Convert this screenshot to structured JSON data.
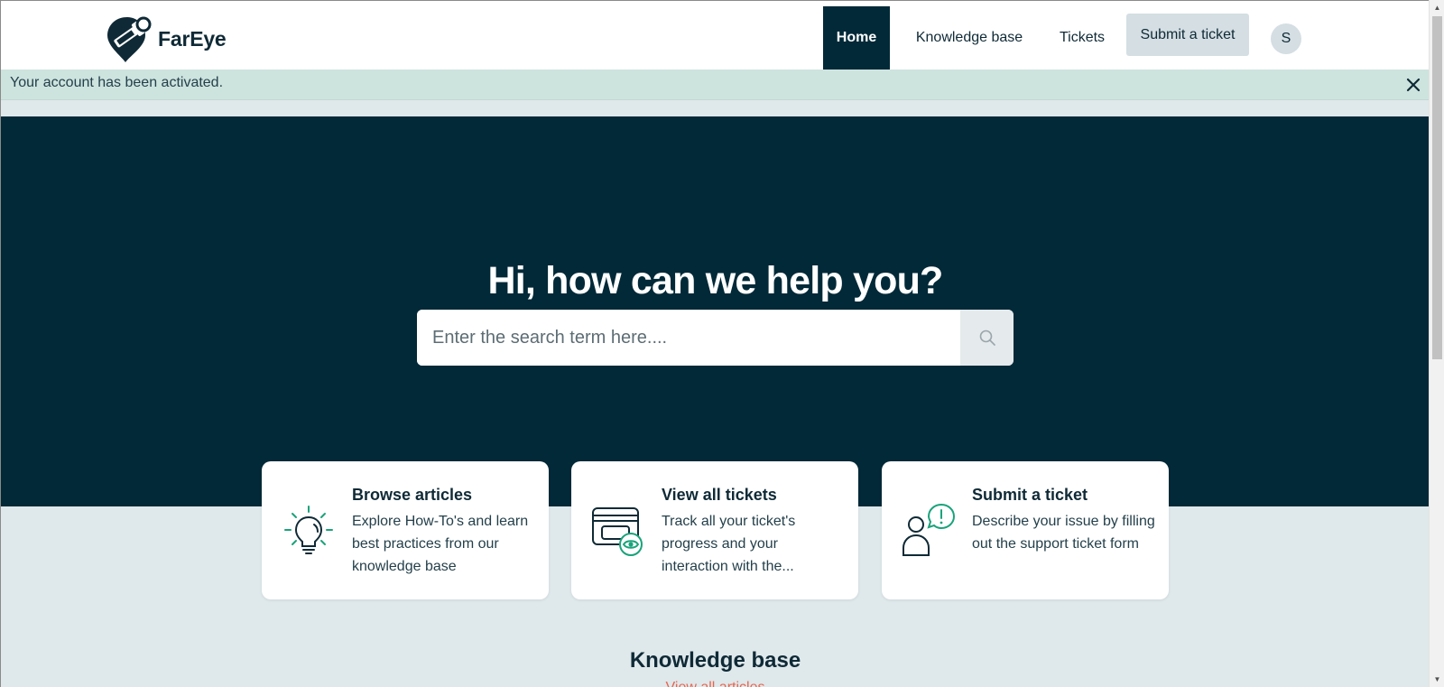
{
  "brand": {
    "name": "FarEye"
  },
  "nav": {
    "home": "Home",
    "knowledge_base": "Knowledge base",
    "tickets": "Tickets",
    "submit": "Submit a ticket",
    "avatar_initial": "S"
  },
  "notice": {
    "text": "Your account has been activated.",
    "close_icon": "close-icon"
  },
  "hero": {
    "title": "Hi, how can we help you?",
    "search_placeholder": "Enter the search term here....",
    "search_value": ""
  },
  "cards": [
    {
      "title": "Browse articles",
      "description": "Explore How-To's and learn best practices from our knowledge base",
      "icon": "lightbulb-icon"
    },
    {
      "title": "View all tickets",
      "description": "Track all your ticket's progress and your interaction with the...",
      "icon": "tickets-eye-icon"
    },
    {
      "title": "Submit a ticket",
      "description": "Describe your issue by filling out the support ticket form",
      "icon": "user-alert-icon"
    }
  ],
  "knowledge_base": {
    "heading": "Knowledge base",
    "link": "View all articles"
  },
  "colors": {
    "brand_dark": "#022938",
    "accent_green": "#1aa37a",
    "notice_bg": "#cde3de",
    "page_bg": "#dfe8eb",
    "link": "#e8654f"
  }
}
